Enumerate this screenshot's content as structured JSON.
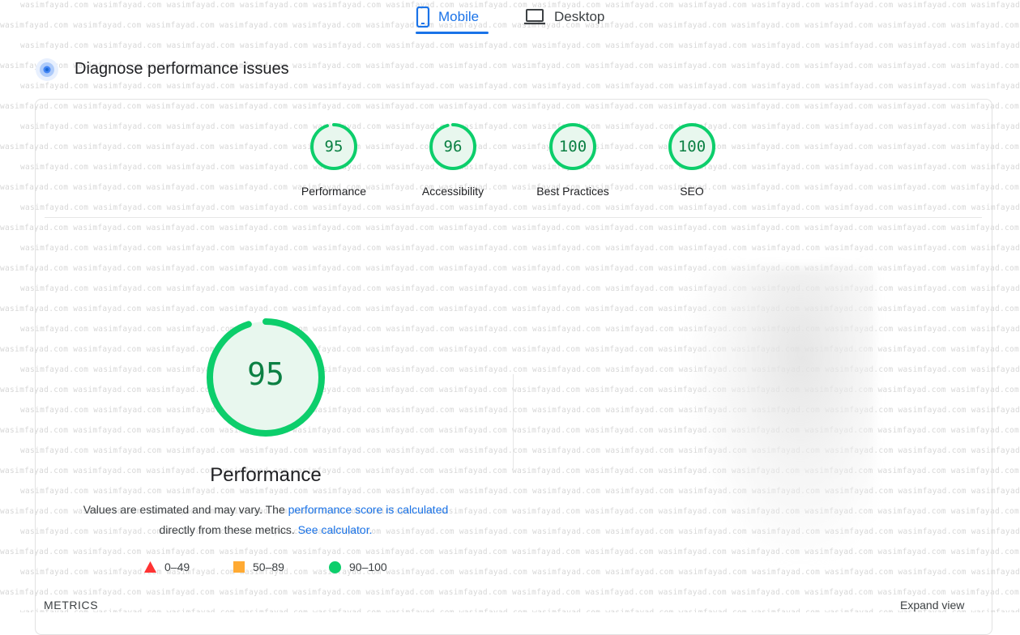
{
  "watermark": {
    "text": "wasimfayad.com"
  },
  "tabs": [
    {
      "label": "Mobile",
      "icon": "smartphone-icon",
      "selected": true
    },
    {
      "label": "Desktop",
      "icon": "laptop-icon",
      "selected": false
    }
  ],
  "section": {
    "title": "Diagnose performance issues"
  },
  "scores": [
    {
      "label": "Performance",
      "value": "95",
      "fraction": 0.95
    },
    {
      "label": "Accessibility",
      "value": "96",
      "fraction": 0.96
    },
    {
      "label": "Best Practices",
      "value": "100",
      "fraction": 1.0
    },
    {
      "label": "SEO",
      "value": "100",
      "fraction": 1.0
    }
  ],
  "performance": {
    "score": "95",
    "fraction": 0.95,
    "title": "Performance",
    "desc_line1_prefix": "Values are estimated and may vary. The ",
    "desc_link1": "performance score is calculated",
    "desc_line2_prefix": "directly from these metrics. ",
    "desc_link2": "See calculator."
  },
  "legend": [
    {
      "range": "0–49",
      "shape": "triangle",
      "color": "#ff3333"
    },
    {
      "range": "50–89",
      "shape": "square",
      "color": "#ffaa33"
    },
    {
      "range": "90–100",
      "shape": "circle",
      "color": "#0cce6b"
    }
  ],
  "metrics": {
    "label": "METRICS",
    "expand": "Expand view"
  },
  "colors": {
    "accent": "#1a73e8",
    "good": "#0cce6b",
    "good_fill": "#e8f7ee",
    "good_text": "#0b8043"
  }
}
